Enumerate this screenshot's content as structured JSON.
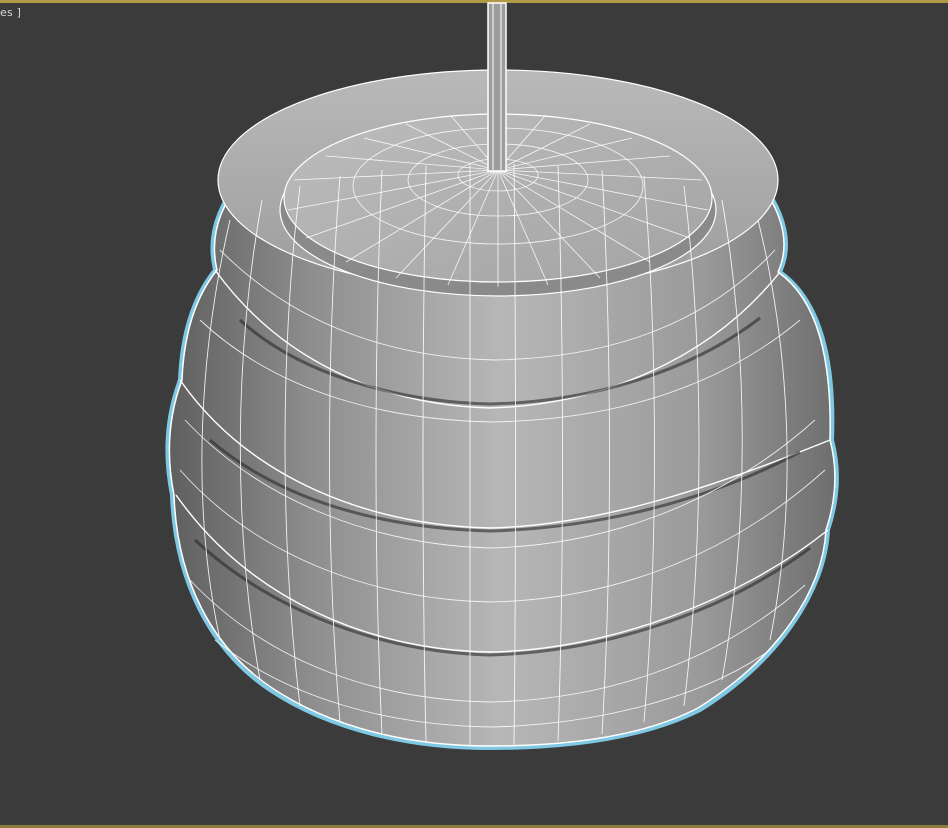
{
  "viewport": {
    "label": "es ]",
    "background": "#3b3b3b",
    "frame_color": "#b09a43",
    "selection_outline_color": "#7ec8e3",
    "wireframe_color": "#ffffff",
    "shaded_color": "#a9a9a9"
  }
}
